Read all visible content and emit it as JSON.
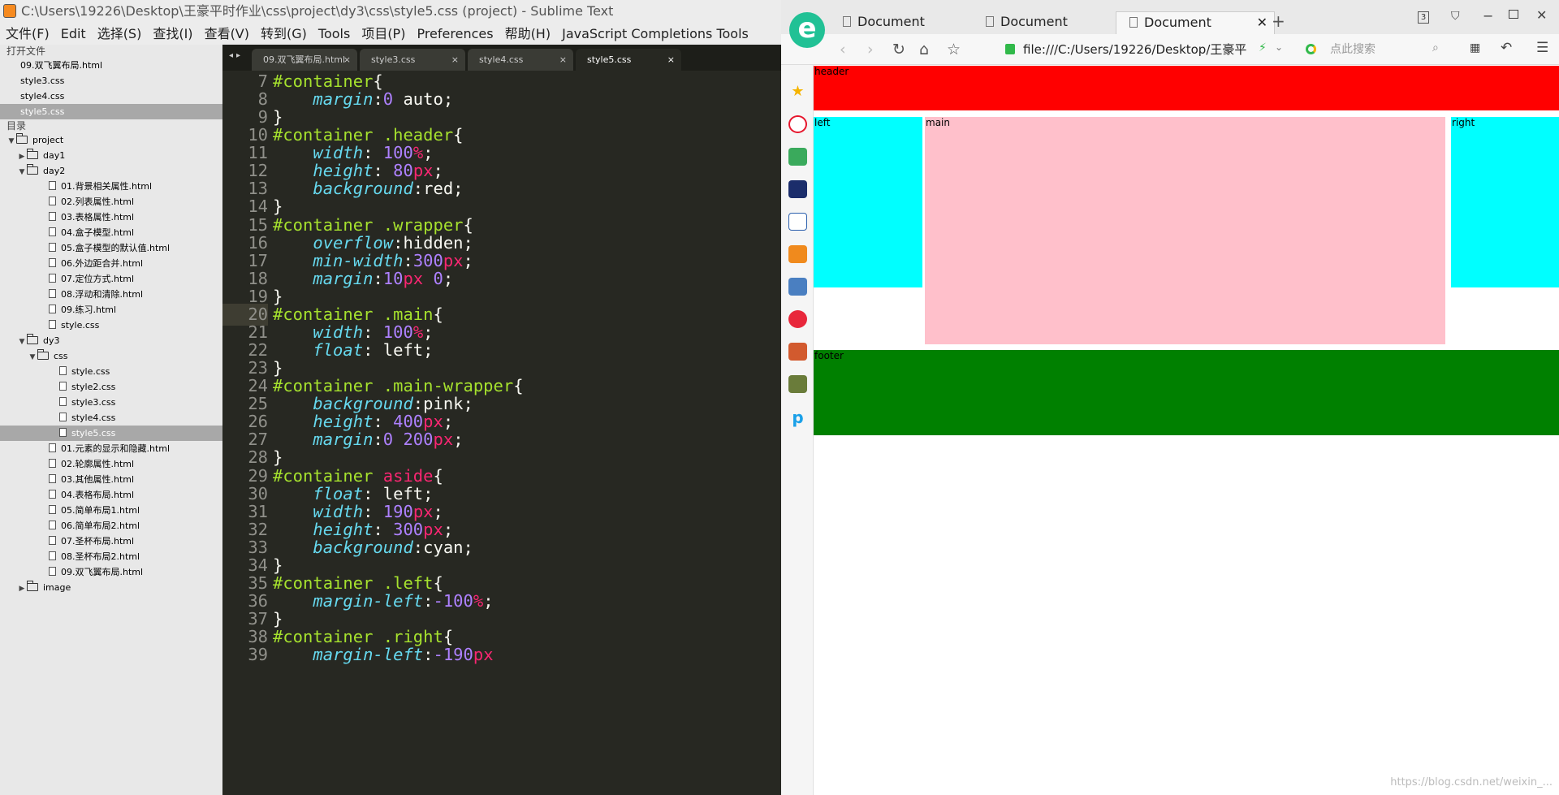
{
  "editor": {
    "title": "C:\\Users\\19226\\Desktop\\王豪平时作业\\css\\project\\dy3\\css\\style5.css (project) - Sublime Text",
    "menu": [
      "文件(F)",
      "Edit",
      "选择(S)",
      "查找(I)",
      "查看(V)",
      "转到(G)",
      "Tools",
      "项目(P)",
      "Preferences",
      "帮助(H)",
      "JavaScript Completions Tools"
    ],
    "open_files_header": "打开文件",
    "open_files": [
      "09.双飞翼布局.html",
      "style3.css",
      "style4.css",
      "style5.css"
    ],
    "dir_header": "目录",
    "tree": [
      {
        "label": "project",
        "type": "folder",
        "level": 0,
        "open": true
      },
      {
        "label": "day1",
        "type": "folder",
        "level": 1,
        "open": false
      },
      {
        "label": "day2",
        "type": "folder",
        "level": 1,
        "open": true
      },
      {
        "label": "01.背景相关属性.html",
        "type": "file",
        "level": 2
      },
      {
        "label": "02.列表属性.html",
        "type": "file",
        "level": 2
      },
      {
        "label": "03.表格属性.html",
        "type": "file",
        "level": 2
      },
      {
        "label": "04.盒子模型.html",
        "type": "file",
        "level": 2
      },
      {
        "label": "05.盒子模型的默认值.html",
        "type": "file",
        "level": 2
      },
      {
        "label": "06.外边距合并.html",
        "type": "file",
        "level": 2
      },
      {
        "label": "07.定位方式.html",
        "type": "file",
        "level": 2
      },
      {
        "label": "08.浮动和清除.html",
        "type": "file",
        "level": 2
      },
      {
        "label": "09.练习.html",
        "type": "file",
        "level": 2
      },
      {
        "label": "style.css",
        "type": "file",
        "level": 2
      },
      {
        "label": "dy3",
        "type": "folder",
        "level": 1,
        "open": true
      },
      {
        "label": "css",
        "type": "folder",
        "level": 2,
        "open": true
      },
      {
        "label": "style.css",
        "type": "file",
        "level": 3
      },
      {
        "label": "style2.css",
        "type": "file",
        "level": 3
      },
      {
        "label": "style3.css",
        "type": "file",
        "level": 3
      },
      {
        "label": "style4.css",
        "type": "file",
        "level": 3
      },
      {
        "label": "style5.css",
        "type": "file",
        "level": 3,
        "selected": true
      },
      {
        "label": "01.元素的显示和隐藏.html",
        "type": "file",
        "level": 2
      },
      {
        "label": "02.轮廓属性.html",
        "type": "file",
        "level": 2
      },
      {
        "label": "03.其他属性.html",
        "type": "file",
        "level": 2
      },
      {
        "label": "04.表格布局.html",
        "type": "file",
        "level": 2
      },
      {
        "label": "05.简单布局1.html",
        "type": "file",
        "level": 2
      },
      {
        "label": "06.简单布局2.html",
        "type": "file",
        "level": 2
      },
      {
        "label": "07.圣杯布局.html",
        "type": "file",
        "level": 2
      },
      {
        "label": "08.圣杯布局2.html",
        "type": "file",
        "level": 2
      },
      {
        "label": "09.双飞翼布局.html",
        "type": "file",
        "level": 2
      },
      {
        "label": "image",
        "type": "folder",
        "level": 1,
        "open": false
      }
    ],
    "tabs": [
      "09.双飞翼布局.html",
      "style3.css",
      "style4.css",
      "style5.css"
    ],
    "active_tab": 3,
    "current_line": 20,
    "code": [
      {
        "n": "7",
        "t": [
          [
            "s",
            "#container"
          ],
          [
            "w",
            "{"
          ]
        ]
      },
      {
        "n": "8",
        "t": [
          [
            "w",
            "    "
          ],
          [
            "p",
            "margin"
          ],
          [
            "w",
            ":"
          ],
          [
            "n",
            "0"
          ],
          [
            "w",
            " auto;"
          ]
        ]
      },
      {
        "n": "9",
        "t": [
          [
            "w",
            "}"
          ]
        ]
      },
      {
        "n": "10",
        "t": [
          [
            "s",
            "#container .header"
          ],
          [
            "w",
            "{"
          ]
        ]
      },
      {
        "n": "11",
        "t": [
          [
            "w",
            "    "
          ],
          [
            "p",
            "width"
          ],
          [
            "w",
            ": "
          ],
          [
            "n",
            "100"
          ],
          [
            "u",
            "%"
          ],
          [
            "w",
            ";"
          ]
        ]
      },
      {
        "n": "12",
        "t": [
          [
            "w",
            "    "
          ],
          [
            "p",
            "height"
          ],
          [
            "w",
            ": "
          ],
          [
            "n",
            "80"
          ],
          [
            "u",
            "px"
          ],
          [
            "w",
            ";"
          ]
        ]
      },
      {
        "n": "13",
        "t": [
          [
            "w",
            "    "
          ],
          [
            "p",
            "background"
          ],
          [
            "w",
            ":red;"
          ]
        ]
      },
      {
        "n": "14",
        "t": [
          [
            "w",
            "}"
          ]
        ]
      },
      {
        "n": "15",
        "t": [
          [
            "s",
            "#container .wrapper"
          ],
          [
            "w",
            "{"
          ]
        ]
      },
      {
        "n": "16",
        "t": [
          [
            "w",
            "    "
          ],
          [
            "p",
            "overflow"
          ],
          [
            "w",
            ":hidden;"
          ]
        ]
      },
      {
        "n": "17",
        "t": [
          [
            "w",
            "    "
          ],
          [
            "p",
            "min-width"
          ],
          [
            "w",
            ":"
          ],
          [
            "n",
            "300"
          ],
          [
            "u",
            "px"
          ],
          [
            "w",
            ";"
          ]
        ]
      },
      {
        "n": "18",
        "t": [
          [
            "w",
            "    "
          ],
          [
            "p",
            "margin"
          ],
          [
            "w",
            ":"
          ],
          [
            "n",
            "10"
          ],
          [
            "u",
            "px"
          ],
          [
            "w",
            " "
          ],
          [
            "n",
            "0"
          ],
          [
            "w",
            ";"
          ]
        ]
      },
      {
        "n": "19",
        "t": [
          [
            "w",
            "}"
          ]
        ]
      },
      {
        "n": "20",
        "t": [
          [
            "s",
            "#container .main"
          ],
          [
            "w",
            "{"
          ]
        ]
      },
      {
        "n": "21",
        "t": [
          [
            "w",
            "    "
          ],
          [
            "p",
            "width"
          ],
          [
            "w",
            ": "
          ],
          [
            "n",
            "100"
          ],
          [
            "u",
            "%"
          ],
          [
            "w",
            ";"
          ]
        ]
      },
      {
        "n": "22",
        "t": [
          [
            "w",
            "    "
          ],
          [
            "p",
            "float"
          ],
          [
            "w",
            ": left;"
          ]
        ]
      },
      {
        "n": "23",
        "t": [
          [
            "w",
            "}"
          ]
        ]
      },
      {
        "n": "24",
        "t": [
          [
            "s",
            "#container .main-wrapper"
          ],
          [
            "w",
            "{"
          ]
        ]
      },
      {
        "n": "25",
        "t": [
          [
            "w",
            "    "
          ],
          [
            "p",
            "background"
          ],
          [
            "w",
            ":pink;"
          ]
        ]
      },
      {
        "n": "26",
        "t": [
          [
            "w",
            "    "
          ],
          [
            "p",
            "height"
          ],
          [
            "w",
            ": "
          ],
          [
            "n",
            "400"
          ],
          [
            "u",
            "px"
          ],
          [
            "w",
            ";"
          ]
        ]
      },
      {
        "n": "27",
        "t": [
          [
            "w",
            "    "
          ],
          [
            "p",
            "margin"
          ],
          [
            "w",
            ":"
          ],
          [
            "n",
            "0"
          ],
          [
            "w",
            " "
          ],
          [
            "n",
            "200"
          ],
          [
            "u",
            "px"
          ],
          [
            "w",
            ";"
          ]
        ]
      },
      {
        "n": "28",
        "t": [
          [
            "w",
            "}"
          ]
        ]
      },
      {
        "n": "29",
        "t": [
          [
            "s",
            "#container "
          ],
          [
            "t",
            "aside"
          ],
          [
            "w",
            "{"
          ]
        ]
      },
      {
        "n": "30",
        "t": [
          [
            "w",
            "    "
          ],
          [
            "p",
            "float"
          ],
          [
            "w",
            ": left;"
          ]
        ]
      },
      {
        "n": "31",
        "t": [
          [
            "w",
            "    "
          ],
          [
            "p",
            "width"
          ],
          [
            "w",
            ": "
          ],
          [
            "n",
            "190"
          ],
          [
            "u",
            "px"
          ],
          [
            "w",
            ";"
          ]
        ]
      },
      {
        "n": "32",
        "t": [
          [
            "w",
            "    "
          ],
          [
            "p",
            "height"
          ],
          [
            "w",
            ": "
          ],
          [
            "n",
            "300"
          ],
          [
            "u",
            "px"
          ],
          [
            "w",
            ";"
          ]
        ]
      },
      {
        "n": "33",
        "t": [
          [
            "w",
            "    "
          ],
          [
            "p",
            "background"
          ],
          [
            "w",
            ":cyan;"
          ]
        ]
      },
      {
        "n": "34",
        "t": [
          [
            "w",
            "}"
          ]
        ]
      },
      {
        "n": "35",
        "t": [
          [
            "s",
            "#container .left"
          ],
          [
            "w",
            "{"
          ]
        ]
      },
      {
        "n": "36",
        "t": [
          [
            "w",
            "    "
          ],
          [
            "p",
            "margin-left"
          ],
          [
            "w",
            ":"
          ],
          [
            "n",
            "-100"
          ],
          [
            "u",
            "%"
          ],
          [
            "w",
            ";"
          ]
        ]
      },
      {
        "n": "37",
        "t": [
          [
            "w",
            "}"
          ]
        ]
      },
      {
        "n": "38",
        "t": [
          [
            "s",
            "#container .right"
          ],
          [
            "w",
            "{"
          ]
        ]
      },
      {
        "n": "39",
        "t": [
          [
            "w",
            "    "
          ],
          [
            "p",
            "margin-left"
          ],
          [
            "w",
            ":"
          ],
          [
            "n",
            "-190"
          ],
          [
            "u",
            "px"
          ]
        ]
      }
    ]
  },
  "browser": {
    "tabs": [
      "Document",
      "Document",
      "Document"
    ],
    "tab_count": "3",
    "url": "file:///C:/Users/19226/Desktop/王豪平",
    "search_placeholder": "点此搜索",
    "page": {
      "header": "header",
      "left": "left",
      "main": "main",
      "right": "right",
      "footer": "footer",
      "colors": {
        "header": "#ff0000",
        "aside": "#00ffff",
        "main": "#ffc0cb",
        "footer": "#008000"
      }
    },
    "watermark": "https://blog.csdn.net/weixin_..."
  }
}
